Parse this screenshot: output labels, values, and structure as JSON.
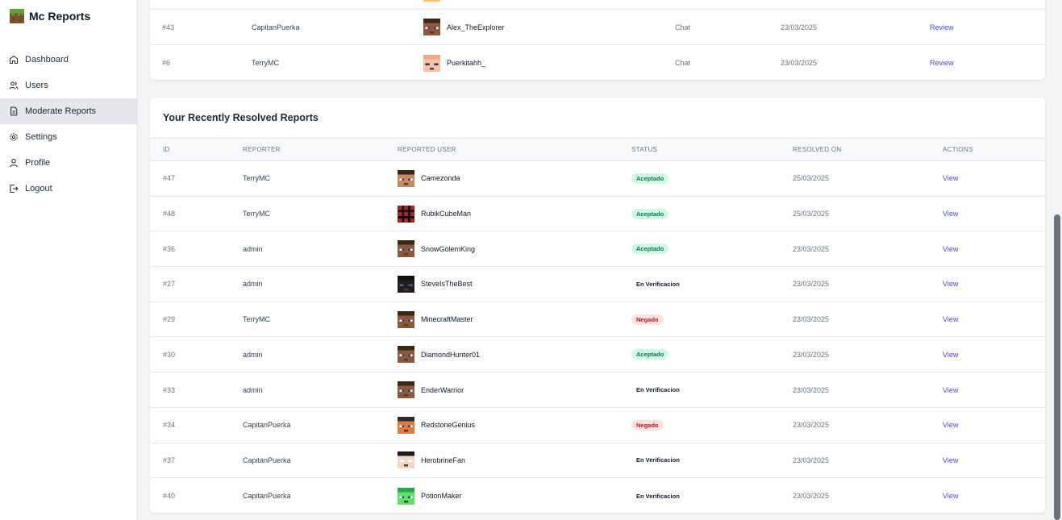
{
  "app": {
    "title": "Mc Reports"
  },
  "sidebar": {
    "items": [
      {
        "label": "Dashboard",
        "icon": "home-icon"
      },
      {
        "label": "Users",
        "icon": "users-icon"
      },
      {
        "label": "Moderate Reports",
        "icon": "document-icon",
        "active": true
      },
      {
        "label": "Settings",
        "icon": "gear-icon"
      },
      {
        "label": "Profile",
        "icon": "user-icon"
      },
      {
        "label": "Logout",
        "icon": "logout-icon"
      }
    ]
  },
  "pending": {
    "rows": [
      {
        "id": "#43",
        "reporter": "CapitanPuerka",
        "reported": "Alex_TheExplorer",
        "skin": "steve",
        "type": "Chat",
        "date": "23/03/2025",
        "action": "Review"
      },
      {
        "id": "#6",
        "reporter": "TerryMC",
        "reported": "Puerkitahh_",
        "skin": "pig",
        "type": "Chat",
        "date": "23/03/2025",
        "action": "Review"
      }
    ]
  },
  "resolved": {
    "title": "Your Recently Resolved Reports",
    "headers": {
      "id": "ID",
      "reporter": "REPORTER",
      "reported": "REPORTED USER",
      "status": "STATUS",
      "resolved_on": "RESOLVED ON",
      "actions": "ACTIONS"
    },
    "rows": [
      {
        "id": "#47",
        "reporter": "TerryMC",
        "reported": "Camezonda",
        "skin": "steve-light",
        "status": "Aceptado",
        "status_kind": "ok",
        "date": "25/03/2025",
        "action": "View"
      },
      {
        "id": "#48",
        "reporter": "TerryMC",
        "reported": "RubikCubeMan",
        "skin": "rubik",
        "status": "Aceptado",
        "status_kind": "ok",
        "date": "25/03/2025",
        "action": "View"
      },
      {
        "id": "#36",
        "reporter": "admin",
        "reported": "SnowGolemKing",
        "skin": "steve",
        "status": "Aceptado",
        "status_kind": "ok",
        "date": "23/03/2025",
        "action": "View"
      },
      {
        "id": "#27",
        "reporter": "admin",
        "reported": "SteveIsTheBest",
        "skin": "dark",
        "status": "En Verificacion",
        "status_kind": "ver",
        "date": "23/03/2025",
        "action": "View"
      },
      {
        "id": "#29",
        "reporter": "TerryMC",
        "reported": "MinecraftMaster",
        "skin": "steve",
        "status": "Negado",
        "status_kind": "neg",
        "date": "23/03/2025",
        "action": "View"
      },
      {
        "id": "#30",
        "reporter": "admin",
        "reported": "DiamondHunter01",
        "skin": "steve",
        "status": "Aceptado",
        "status_kind": "ok",
        "date": "23/03/2025",
        "action": "View"
      },
      {
        "id": "#33",
        "reporter": "admin",
        "reported": "EnderWarrior",
        "skin": "steve",
        "status": "En Verificacion",
        "status_kind": "ver",
        "date": "23/03/2025",
        "action": "View"
      },
      {
        "id": "#34",
        "reporter": "CapitanPuerka",
        "reported": "RedstoneGenius",
        "skin": "redstone",
        "status": "Negado",
        "status_kind": "neg",
        "date": "23/03/2025",
        "action": "View"
      },
      {
        "id": "#37",
        "reporter": "CapitanPuerka",
        "reported": "HerobrineFan",
        "skin": "herobrine",
        "status": "En Verificacion",
        "status_kind": "ver",
        "date": "23/03/2025",
        "action": "View"
      },
      {
        "id": "#40",
        "reporter": "CapitanPuerka",
        "reported": "PotionMaker",
        "skin": "potion",
        "status": "En Verificacion",
        "status_kind": "ver",
        "date": "23/03/2025",
        "action": "View"
      }
    ]
  }
}
